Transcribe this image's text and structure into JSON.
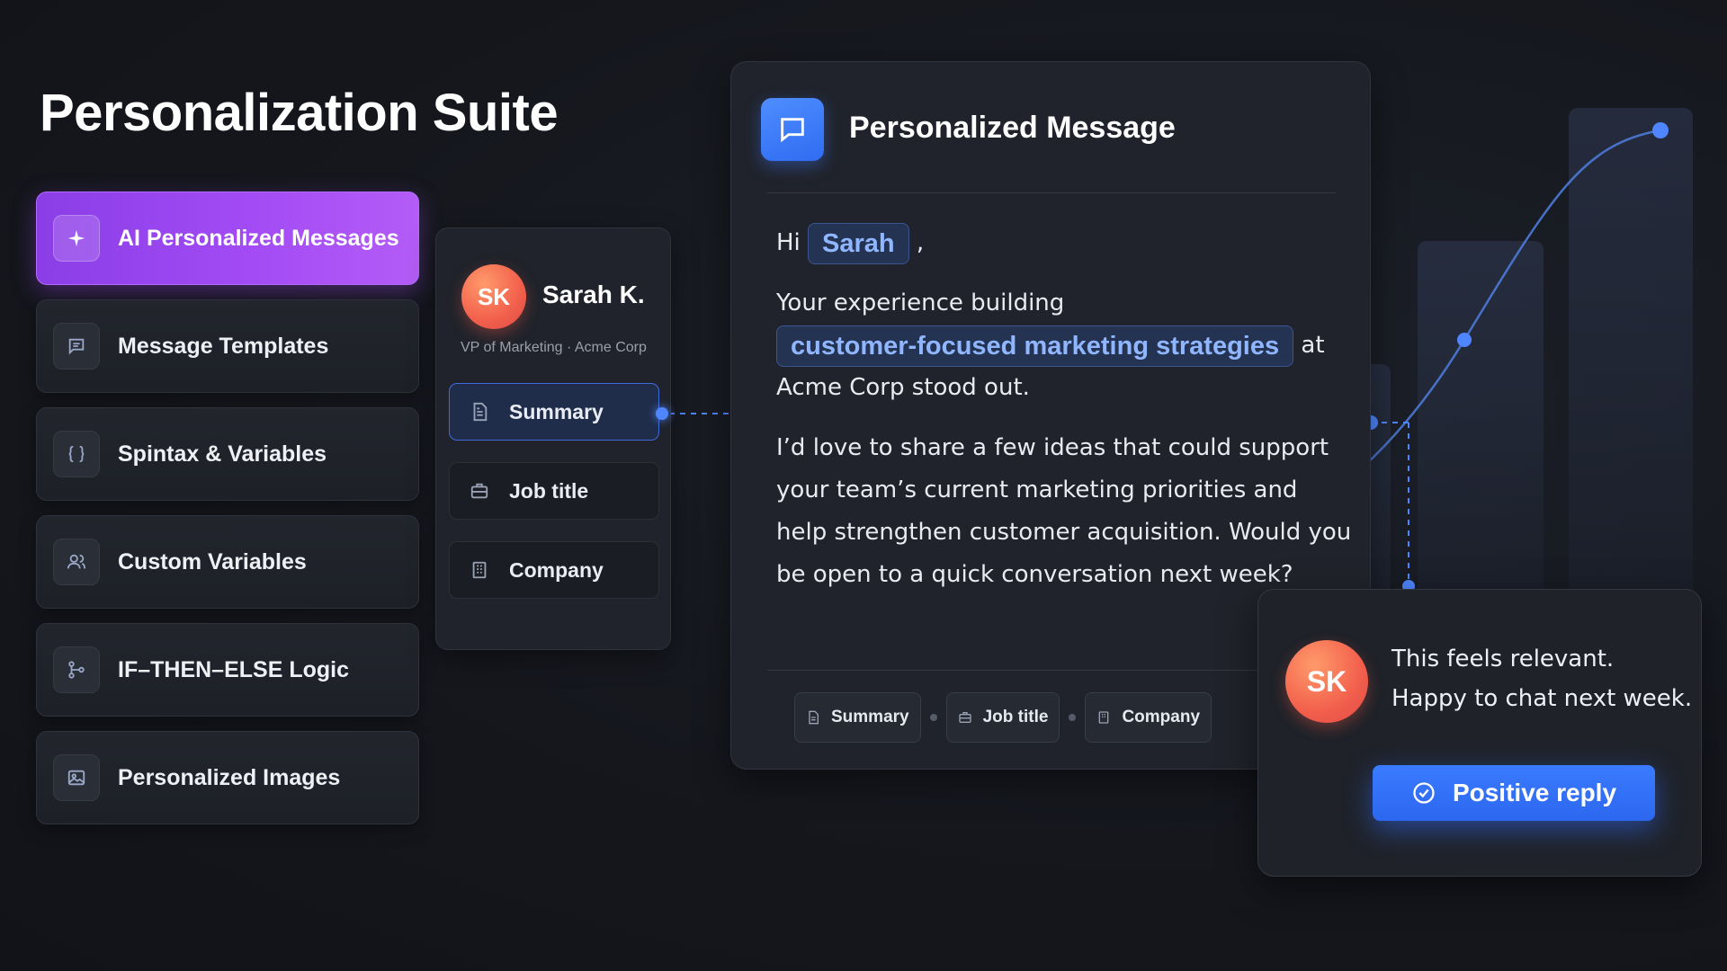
{
  "page": {
    "title": "Personalization Suite"
  },
  "menu": {
    "items": [
      {
        "label": "AI Personalized Messages",
        "icon": "sparkle-icon",
        "active": true
      },
      {
        "label": "Message Templates",
        "icon": "message-template-icon"
      },
      {
        "label": "Spintax & Variables",
        "icon": "curly-braces-icon"
      },
      {
        "label": "Custom Variables",
        "icon": "users-icon"
      },
      {
        "label": "IF–THEN–ELSE Logic",
        "icon": "branch-icon"
      },
      {
        "label": "Personalized Images",
        "icon": "image-icon"
      }
    ]
  },
  "profile": {
    "initials": "SK",
    "name": "Sarah K.",
    "role": "VP of Marketing · Acme Corp",
    "fields": [
      {
        "label": "Summary",
        "icon": "document-icon",
        "selected": true
      },
      {
        "label": "Job title",
        "icon": "briefcase-icon"
      },
      {
        "label": "Company",
        "icon": "building-icon"
      }
    ]
  },
  "message": {
    "title": "Personalized Message",
    "greeting": "Hi",
    "name_chip": "Sarah",
    "greeting_end": ",",
    "p1_start": "Your experience building",
    "p1_chip": "customer-focused marketing strategies",
    "p1_mid": "at",
    "p1_end": "Acme Corp stood out.",
    "p2": "I’d love to share a few ideas that could support your team’s current marketing priorities and help strengthen customer acquisition. Would you be open to a quick conversation next week?",
    "tags": [
      "Summary",
      "Job title",
      "Company"
    ]
  },
  "reply": {
    "initials": "SK",
    "line1": "This feels relevant.",
    "line2": "Happy to chat next week.",
    "button_label": "Positive reply"
  },
  "colors": {
    "accent_purple": "#a24bf5",
    "accent_blue": "#3a7bff",
    "avatar": "#f25f4c"
  }
}
